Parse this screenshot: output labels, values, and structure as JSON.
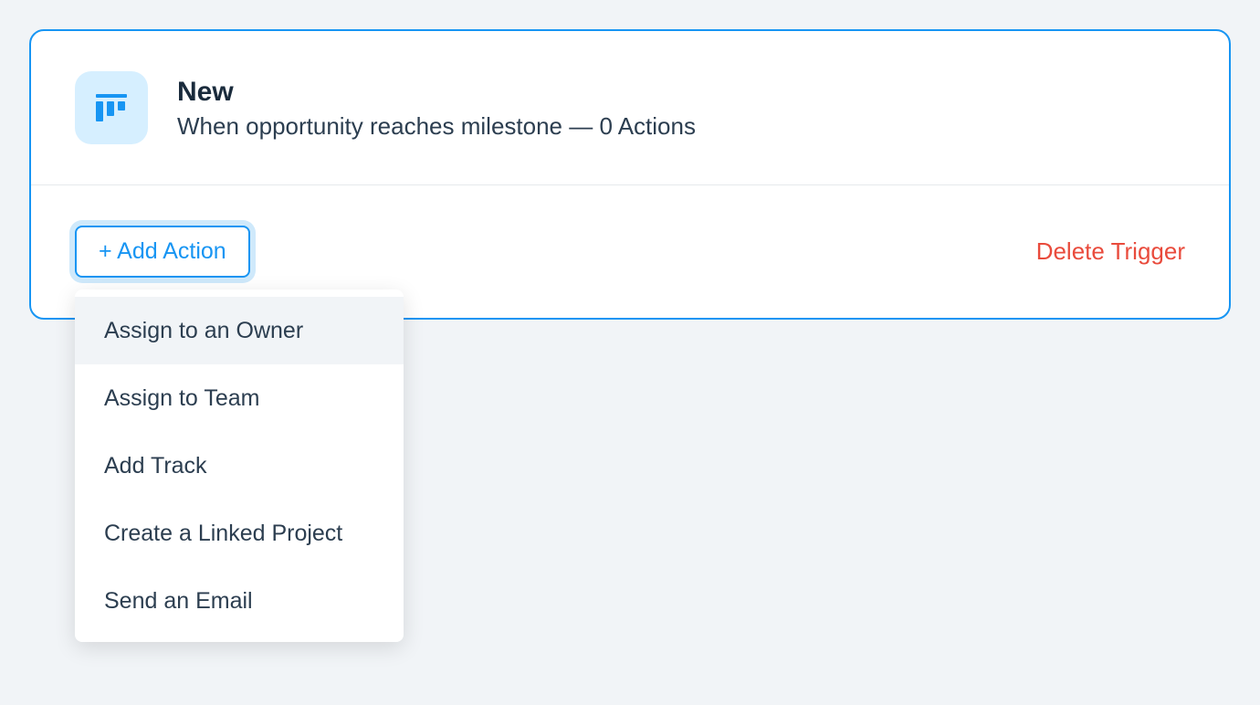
{
  "trigger": {
    "title": "New",
    "subtitle": "When opportunity reaches milestone — 0 Actions",
    "icon_name": "kanban-icon"
  },
  "buttons": {
    "add_action": "+ Add Action",
    "delete_trigger": "Delete Trigger"
  },
  "dropdown": {
    "items": [
      "Assign to an Owner",
      "Assign to Team",
      "Add Track",
      "Create a Linked Project",
      "Send an Email"
    ],
    "hovered_index": 0
  },
  "colors": {
    "accent": "#1795f3",
    "danger": "#e94b3c",
    "icon_bg": "#d6efff"
  }
}
